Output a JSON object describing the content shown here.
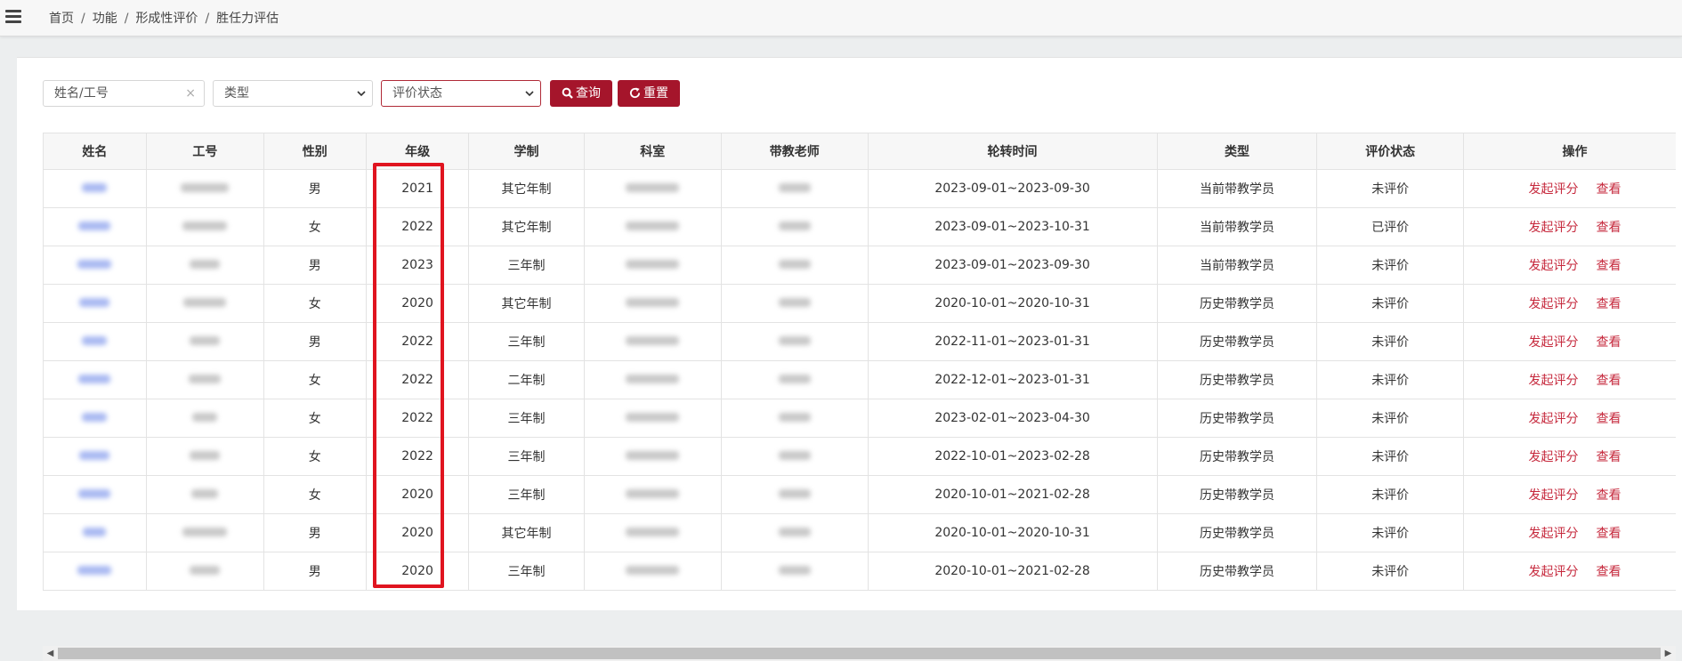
{
  "breadcrumb": [
    "首页",
    "功能",
    "形成性评价",
    "胜任力评估"
  ],
  "filters": {
    "name_placeholder": "姓名/工号",
    "clear": "×",
    "type_label": "类型",
    "status_label": "评价状态",
    "query_label": "查询",
    "reset_label": "重置"
  },
  "colors": {
    "accent": "#a5152b",
    "highlight": "#e0141f",
    "link": "#c6293d"
  },
  "table": {
    "headers": [
      "姓名",
      "工号",
      "性别",
      "年级",
      "学制",
      "科室",
      "带教老师",
      "轮转时间",
      "类型",
      "评价状态",
      "操作"
    ],
    "rows": [
      {
        "gender": "男",
        "grade": "2021",
        "system": "其它年制",
        "rotation": "2023-09-01~2023-09-30",
        "type": "当前带教学员",
        "status": "未评价"
      },
      {
        "gender": "女",
        "grade": "2022",
        "system": "其它年制",
        "rotation": "2023-09-01~2023-10-31",
        "type": "当前带教学员",
        "status": "已评价"
      },
      {
        "gender": "男",
        "grade": "2023",
        "system": "三年制",
        "rotation": "2023-09-01~2023-09-30",
        "type": "当前带教学员",
        "status": "未评价"
      },
      {
        "gender": "女",
        "grade": "2020",
        "system": "其它年制",
        "rotation": "2020-10-01~2020-10-31",
        "type": "历史带教学员",
        "status": "未评价"
      },
      {
        "gender": "男",
        "grade": "2022",
        "system": "三年制",
        "rotation": "2022-11-01~2023-01-31",
        "type": "历史带教学员",
        "status": "未评价"
      },
      {
        "gender": "女",
        "grade": "2022",
        "system": "二年制",
        "rotation": "2022-12-01~2023-01-31",
        "type": "历史带教学员",
        "status": "未评价"
      },
      {
        "gender": "女",
        "grade": "2022",
        "system": "三年制",
        "rotation": "2023-02-01~2023-04-30",
        "type": "历史带教学员",
        "status": "未评价"
      },
      {
        "gender": "女",
        "grade": "2022",
        "system": "三年制",
        "rotation": "2022-10-01~2023-02-28",
        "type": "历史带教学员",
        "status": "未评价"
      },
      {
        "gender": "女",
        "grade": "2020",
        "system": "三年制",
        "rotation": "2020-10-01~2021-02-28",
        "type": "历史带教学员",
        "status": "未评价"
      },
      {
        "gender": "男",
        "grade": "2020",
        "system": "其它年制",
        "rotation": "2020-10-01~2020-10-31",
        "type": "历史带教学员",
        "status": "未评价"
      },
      {
        "gender": "男",
        "grade": "2020",
        "system": "三年制",
        "rotation": "2020-10-01~2021-02-28",
        "type": "历史带教学员",
        "status": "未评价"
      }
    ],
    "actions": {
      "evaluate": "发起评分",
      "view": "查看"
    }
  }
}
